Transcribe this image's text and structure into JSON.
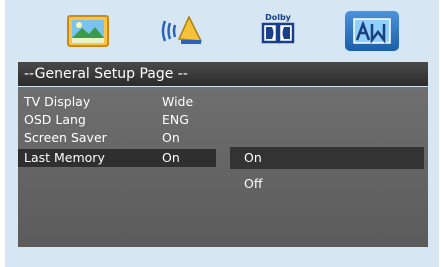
{
  "top_icons": [
    {
      "name": "general-setup-icon"
    },
    {
      "name": "audio-setup-icon"
    },
    {
      "name": "dolby-setup-icon",
      "caption": "Dolby"
    },
    {
      "name": "preferences-setup-icon"
    }
  ],
  "page_title": "--General Setup Page --",
  "menu": [
    {
      "label": "TV Display",
      "value": "Wide"
    },
    {
      "label": "OSD Lang",
      "value": "ENG"
    },
    {
      "label": "Screen Saver",
      "value": "On"
    },
    {
      "label": "Last Memory",
      "value": "On"
    }
  ],
  "options": [
    {
      "label": "On"
    },
    {
      "label": "Off"
    }
  ],
  "colors": {
    "background": "#d6e6f3",
    "panel": "#636363",
    "title_bar": "#333333",
    "highlight": "#2f2f2f",
    "active_tab": "#2d75c4"
  }
}
